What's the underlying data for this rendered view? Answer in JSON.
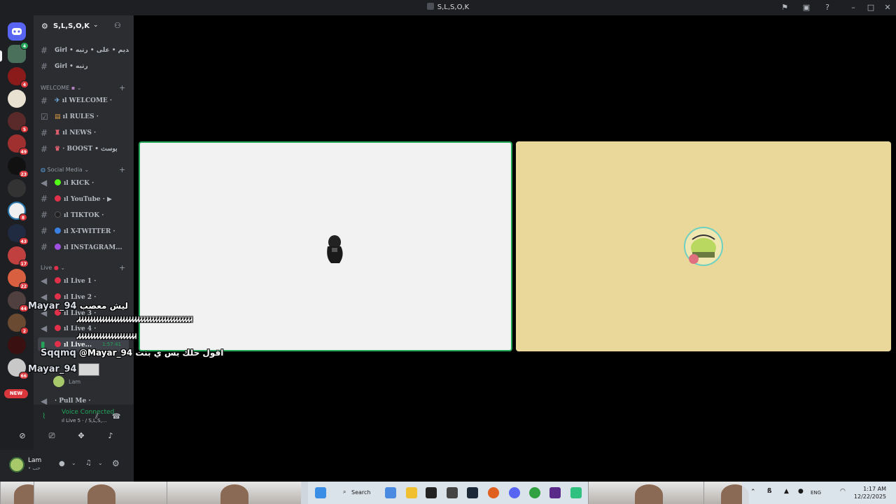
{
  "window": {
    "title": "S,L,S,O,K"
  },
  "rail": {
    "badges": [
      "4",
      "",
      "5",
      "49",
      "23",
      "",
      "8",
      "43",
      "17",
      "22",
      "44",
      "2",
      "",
      "66"
    ],
    "new_label": "NEW"
  },
  "server": {
    "name": "S,L,S,O,K"
  },
  "channels": {
    "top": [
      {
        "label": "Girl • تقديم • على • رتبه"
      },
      {
        "label": "Girl • رتبه"
      }
    ],
    "welcome_category": "WELCOME",
    "welcome": [
      {
        "label": "ıl WELCOME ·"
      },
      {
        "label": "ıl RULES ·"
      },
      {
        "label": "ıl NEWS ·"
      },
      {
        "label": "· BOOST • بوست"
      }
    ],
    "social_category": "Social Media",
    "social": [
      {
        "label": "ıl KICK ·"
      },
      {
        "label": "ıl YouTube · ▶"
      },
      {
        "label": "ıl TIKTOK ·"
      },
      {
        "label": "ıl X-TWITTER ·"
      },
      {
        "label": "ıl INSTAGRAM..."
      }
    ],
    "live_category": "Live",
    "live": [
      {
        "label": "ıl Live 1 ·"
      },
      {
        "label": "ıl Live 2 ·"
      },
      {
        "label": "ıl Live 3 ·"
      },
      {
        "label": "ıl Live 4 ·"
      },
      {
        "label": "ıl Live...",
        "time": "1:57:41"
      }
    ],
    "voice_member": "Lam",
    "pull_me": "· Pull Me ·"
  },
  "voice_panel": {
    "status": "Voice Connected",
    "sub": "ıl Live 5 · / S,L,S,..."
  },
  "user": {
    "name": "Lam",
    "status": "• حب"
  },
  "overlay": {
    "msg1_name": "Mayar_94",
    "msg1_text": "ليش معصب",
    "msg2_name": "Sqqmq",
    "msg2_text": "@Mayar_94 اقول حلك بس ي بنت",
    "msg3_name": "Mayar_94",
    "spam1": "ᏗᏗᏗᏗᏗᏗᏗᏗᏗᏗᏗᏗᏗᏗᏗᏗᏗᏗᏗᏗᏗᏗᏗᏗᏗᏗᏗᏗᏗᏗᏗᏗᏗᏗᏗᏗᏗᏗᏗ",
    "spam2": "ᏗᏗᏗᏗᏗᏗᏗᏗᏗᏗᏗᏗᏗᏗᏗᏗᏗᏗᏗᏗ"
  },
  "taskbar": {
    "search": "Search",
    "lang": "ENG",
    "time": "1:17 AM",
    "date": "12/22/2025"
  },
  "colors": {
    "accent_green": "#23a55a",
    "tile2_bg": "#ead89a",
    "badge_red": "#da373c"
  }
}
